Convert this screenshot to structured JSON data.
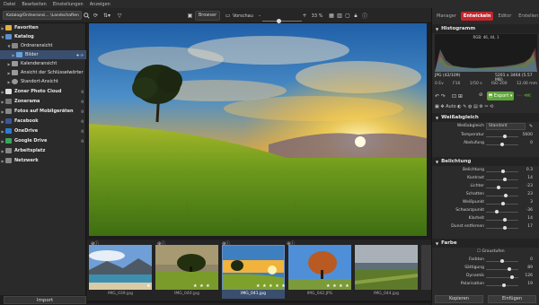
{
  "menu": {
    "items": [
      "Datei",
      "Bearbeiten",
      "Einstellungen",
      "Anzeigen"
    ]
  },
  "toolbar": {
    "path": "Katalog/Ordneransi... \\Landschaften",
    "browse_label": "Browser",
    "preview_label": "Vorschau",
    "zoom": "33 %"
  },
  "sidebar": {
    "items": [
      {
        "label": "Favoriten",
        "bold": true,
        "count": ""
      },
      {
        "label": "Katalog",
        "bold": true,
        "count": ""
      },
      {
        "label": "Ordneransicht",
        "bold": false,
        "count": ""
      },
      {
        "label": "Bilder",
        "bold": false,
        "count": "",
        "selected": true
      },
      {
        "label": "Kalenderansicht",
        "bold": false,
        "count": ""
      },
      {
        "label": "Ansicht der Schlüsselwörter",
        "bold": false,
        "count": ""
      },
      {
        "label": "Standort-Ansicht",
        "bold": false,
        "count": ""
      },
      {
        "label": "Zoner Photo Cloud",
        "bold": true,
        "count": "0"
      },
      {
        "label": "Zonerama",
        "bold": true,
        "count": "0"
      },
      {
        "label": "Fotos auf Mobilgeräten",
        "bold": true,
        "count": "0"
      },
      {
        "label": "Facebook",
        "bold": true,
        "count": "0"
      },
      {
        "label": "OneDrive",
        "bold": true,
        "count": "0"
      },
      {
        "label": "Google Drive",
        "bold": true,
        "count": "0"
      },
      {
        "label": "Arbeitsplatz",
        "bold": true,
        "count": ""
      },
      {
        "label": "Netzwerk",
        "bold": true,
        "count": ""
      }
    ],
    "import_label": "Import"
  },
  "filmstrip": {
    "items": [
      {
        "caption": "IMG_039.jpg",
        "stars": "★"
      },
      {
        "caption": "IMG_040.jpg",
        "stars": "★ ★ ★"
      },
      {
        "caption": "IMG_041.jpg",
        "stars": "★ ★ ★ ★ ★"
      },
      {
        "caption": "IMG_042.JPG",
        "stars": "★ ★ ★ ★"
      },
      {
        "caption": "IMG_044.jpg",
        "stars": ""
      }
    ]
  },
  "right": {
    "tabs": [
      "Manager",
      "Entwickeln",
      "Editor",
      "Erstellen"
    ],
    "hist_title": "Histogramm",
    "rgb": "RGB: 46, 44, 1",
    "info": {
      "format": "JPG",
      "index": "(42/109)",
      "size": "5201 x 3464 (5.57 MB)",
      "ev": "0 Ev",
      "aperture": "F16",
      "iso": "ISO 200",
      "focal": "12.00 mm",
      "shutter": "1/50 s"
    },
    "export_label": "Export",
    "wb": {
      "title": "Weißabgleich",
      "preset_label": "Weißabgleich",
      "preset_value": "Standard",
      "rows": [
        {
          "label": "Temperatur",
          "value": "5600",
          "pos": 0.58
        },
        {
          "label": "Abstufung",
          "value": "0",
          "pos": 0.5
        }
      ]
    },
    "exposure": {
      "title": "Belichtung",
      "rows": [
        {
          "label": "Belichtung",
          "value": "0.3",
          "pos": 0.54
        },
        {
          "label": "Kontrast",
          "value": "14",
          "pos": 0.57
        },
        {
          "label": "Lichter",
          "value": "-23",
          "pos": 0.4
        },
        {
          "label": "Schatten",
          "value": "23",
          "pos": 0.6
        },
        {
          "label": "Weißpunkt",
          "value": "3",
          "pos": 0.52
        },
        {
          "label": "Schwarzpunkt",
          "value": "-36",
          "pos": 0.33
        },
        {
          "label": "Klarheit",
          "value": "14",
          "pos": 0.57
        },
        {
          "label": "Dunst entfernen",
          "value": "17",
          "pos": 0.58
        }
      ]
    },
    "color": {
      "title": "Farbe",
      "sub": "Graustufen",
      "rows": [
        {
          "label": "Farbton",
          "value": "0",
          "pos": 0.5
        },
        {
          "label": "Sättigung",
          "value": "89",
          "pos": 0.72
        },
        {
          "label": "Dynamik",
          "value": "126",
          "pos": 0.8
        },
        {
          "label": "Polarisation",
          "value": "19",
          "pos": 0.56
        }
      ]
    },
    "copy_label": "Kopieren",
    "paste_label": "Einfügen"
  },
  "colors": {
    "accent": "#c2272d",
    "selected": "#3a4e6e",
    "export_green": "#5fa63a"
  }
}
